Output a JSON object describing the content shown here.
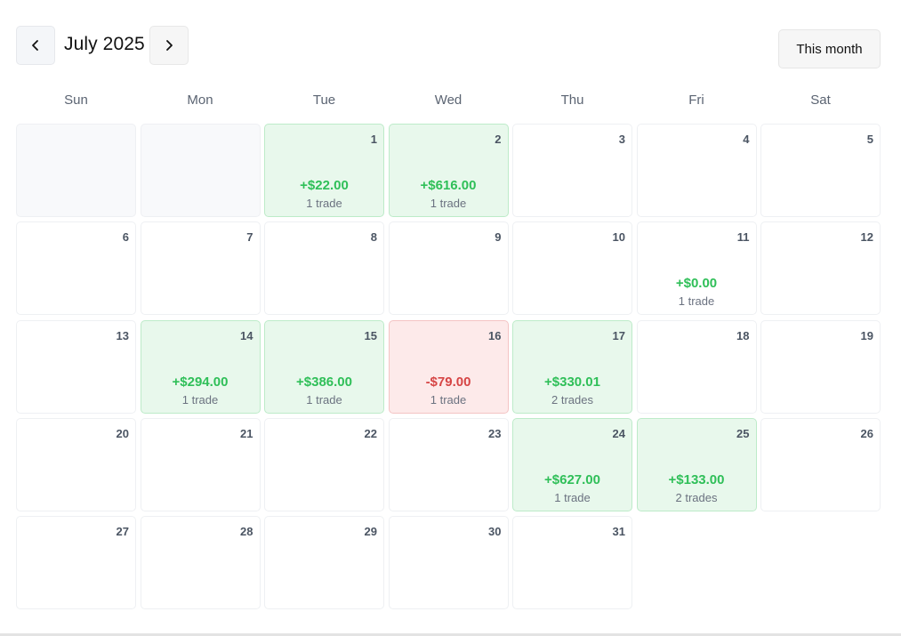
{
  "header": {
    "month_title": "July 2025",
    "prev_icon": "chevron-left-icon",
    "next_icon": "chevron-right-icon",
    "this_month_label": "This month"
  },
  "weekdays": [
    "Sun",
    "Mon",
    "Tue",
    "Wed",
    "Thu",
    "Fri",
    "Sat"
  ],
  "colors": {
    "profit": "#2fbf58",
    "profit_bg": "#e8f8ec",
    "loss": "#d64545",
    "loss_bg": "#fdeaea"
  },
  "calendar": {
    "leading_empty_days": 2,
    "days": [
      {
        "day": "1",
        "pnl": "+$22.00",
        "trades": "1 trade",
        "status": "profit"
      },
      {
        "day": "2",
        "pnl": "+$616.00",
        "trades": "1 trade",
        "status": "profit"
      },
      {
        "day": "3"
      },
      {
        "day": "4"
      },
      {
        "day": "5"
      },
      {
        "day": "6"
      },
      {
        "day": "7"
      },
      {
        "day": "8"
      },
      {
        "day": "9"
      },
      {
        "day": "10"
      },
      {
        "day": "11",
        "pnl": "+$0.00",
        "trades": "1 trade",
        "status": "profit-neutral"
      },
      {
        "day": "12"
      },
      {
        "day": "13"
      },
      {
        "day": "14",
        "pnl": "+$294.00",
        "trades": "1 trade",
        "status": "profit"
      },
      {
        "day": "15",
        "pnl": "+$386.00",
        "trades": "1 trade",
        "status": "profit"
      },
      {
        "day": "16",
        "pnl": "-$79.00",
        "trades": "1 trade",
        "status": "loss"
      },
      {
        "day": "17",
        "pnl": "+$330.01",
        "trades": "2 trades",
        "status": "profit"
      },
      {
        "day": "18"
      },
      {
        "day": "19"
      },
      {
        "day": "20"
      },
      {
        "day": "21"
      },
      {
        "day": "22"
      },
      {
        "day": "23"
      },
      {
        "day": "24",
        "pnl": "+$627.00",
        "trades": "1 trade",
        "status": "profit"
      },
      {
        "day": "25",
        "pnl": "+$133.00",
        "trades": "2 trades",
        "status": "profit"
      },
      {
        "day": "26"
      },
      {
        "day": "27"
      },
      {
        "day": "28"
      },
      {
        "day": "29"
      },
      {
        "day": "30"
      },
      {
        "day": "31"
      }
    ]
  }
}
